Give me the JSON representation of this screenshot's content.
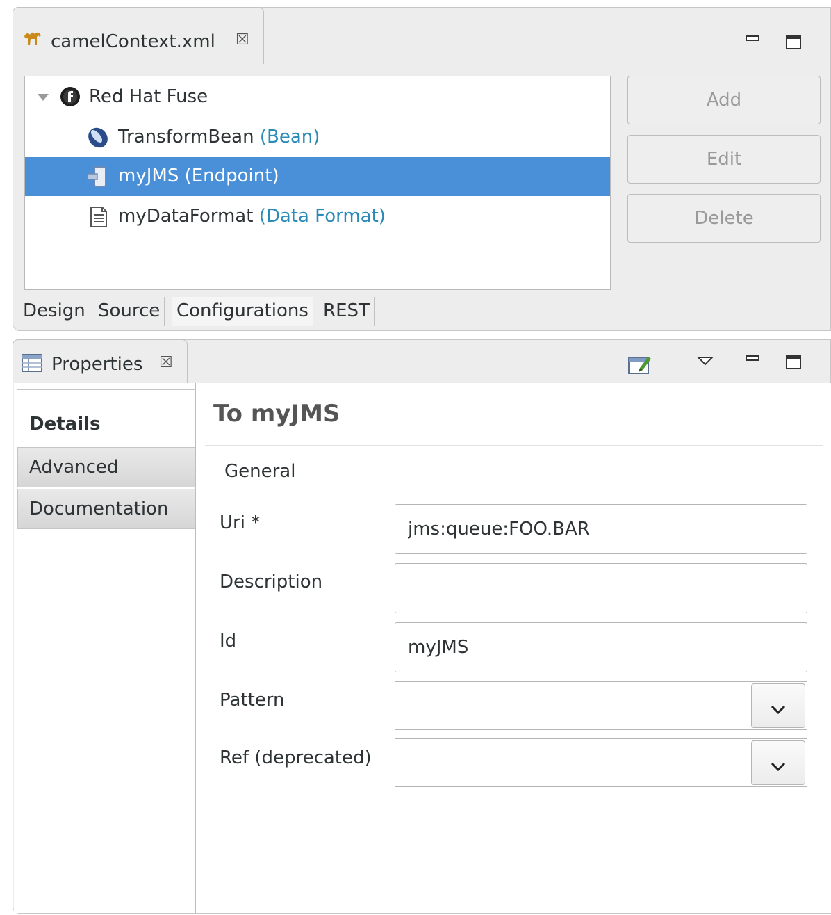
{
  "editor": {
    "tab_title": "camelContext.xml",
    "close_glyph": "☒",
    "tree": {
      "root": {
        "label": "Red Hat Fuse"
      },
      "items": [
        {
          "name": "TransformBean",
          "kind": "(Bean)",
          "icon": "bean-icon",
          "selected": false
        },
        {
          "name": "myJMS",
          "kind": "(Endpoint)",
          "icon": "endpoint-icon",
          "selected": true
        },
        {
          "name": "myDataFormat",
          "kind": "(Data Format)",
          "icon": "document-icon",
          "selected": false
        }
      ]
    },
    "buttons": {
      "add": "Add",
      "edit": "Edit",
      "delete": "Delete"
    },
    "bottom_tabs": [
      "Design",
      "Source",
      "Configurations",
      "REST"
    ],
    "active_bottom_tab": "Configurations"
  },
  "properties": {
    "tab_title": "Properties",
    "close_glyph": "☒",
    "side_tabs": [
      "Details",
      "Advanced",
      "Documentation"
    ],
    "active_side_tab": "Details",
    "form": {
      "title": "To myJMS",
      "section": "General",
      "fields": {
        "uri": {
          "label": "Uri *",
          "value": "jms:queue:FOO.BAR"
        },
        "description": {
          "label": "Description",
          "value": ""
        },
        "id": {
          "label": "Id",
          "value": "myJMS"
        },
        "pattern": {
          "label": "Pattern",
          "value": ""
        },
        "ref": {
          "label": "Ref (deprecated)",
          "value": ""
        }
      }
    }
  },
  "colors": {
    "selection": "#4a90d9",
    "kind_text": "#2a8ab8",
    "panel_bg": "#ededed"
  }
}
